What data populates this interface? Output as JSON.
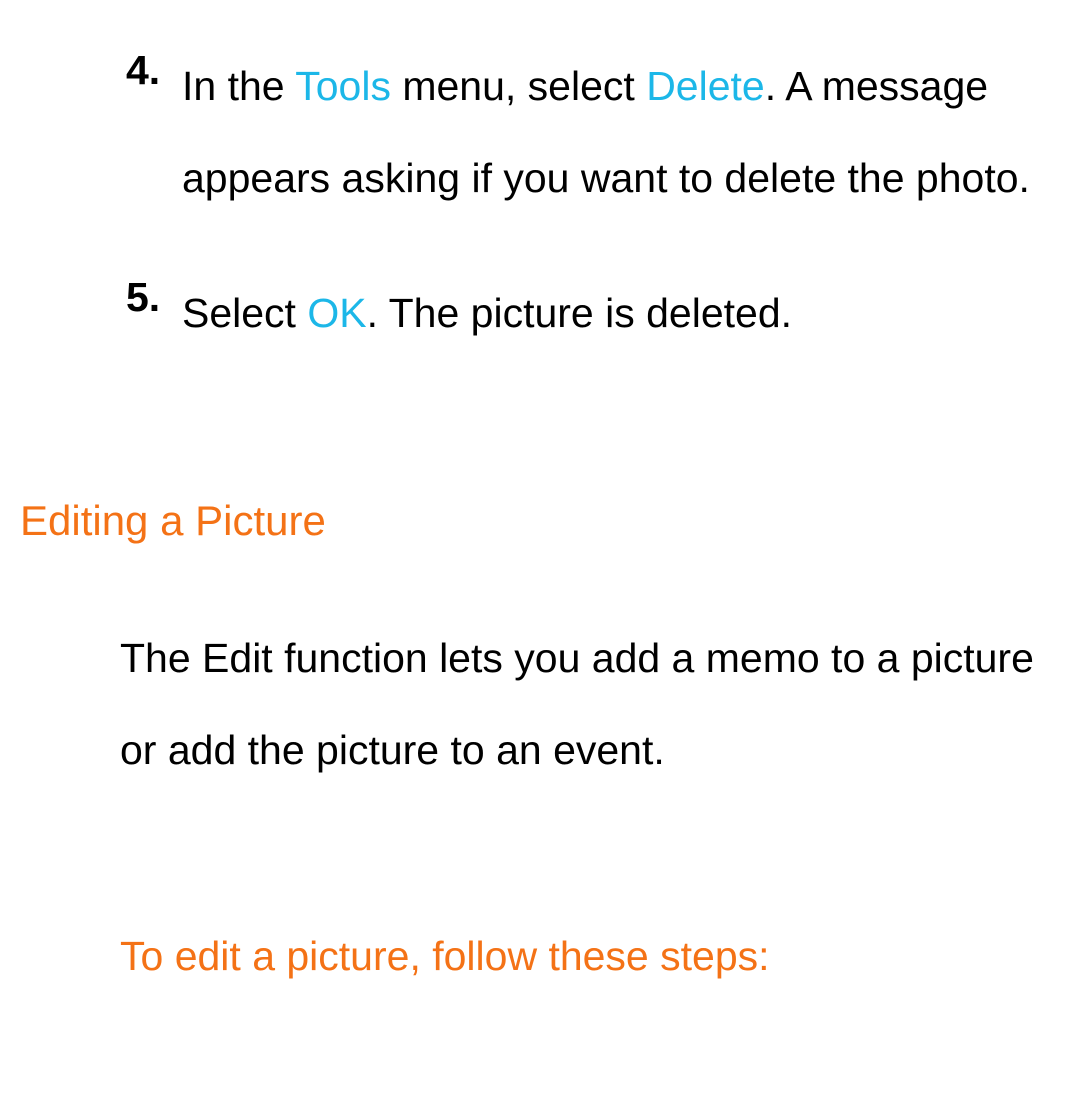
{
  "steps": {
    "item4": {
      "number": "4.",
      "text_before_tools": "In the ",
      "tools_word": "Tools",
      "text_between": " menu, select ",
      "delete_word": "Delete",
      "text_after": ". A message appears asking if you want to delete the photo."
    },
    "item5": {
      "number": "5.",
      "text_before_ok": "Select ",
      "ok_word": "OK",
      "text_after": ". The picture is deleted."
    }
  },
  "section": {
    "heading": "Editing a Picture",
    "body": "The Edit function lets you add a memo to a picture or add the picture to an event.",
    "subheading": "To edit a picture, follow these steps:"
  }
}
